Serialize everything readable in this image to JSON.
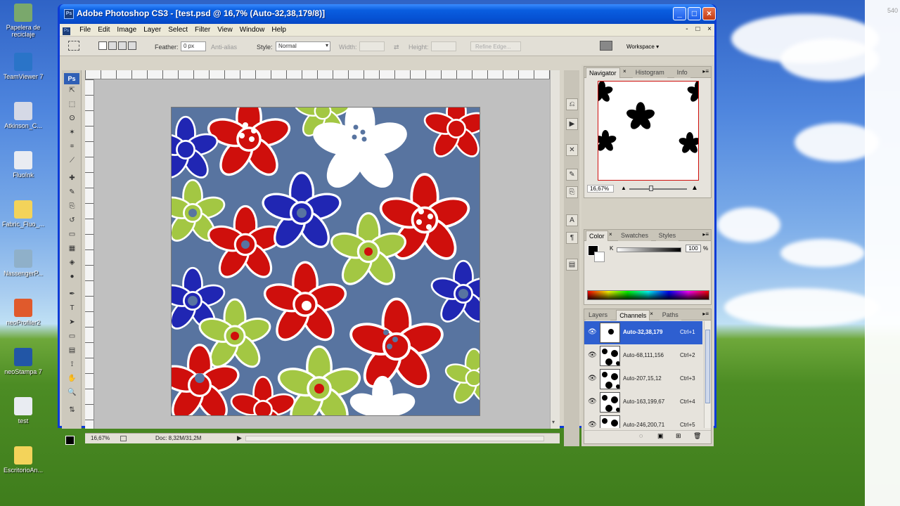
{
  "desktop": {
    "icons": [
      {
        "label": "Papelera de reciclaje",
        "icon": "recycle-bin-icon",
        "color": "#7aa86c"
      },
      {
        "label": "TeamViewer 7",
        "icon": "teamviewer-icon",
        "color": "#2a74c8"
      },
      {
        "label": "Atkinson_C...",
        "icon": "tiff-file-icon",
        "color": "#d5d9e6"
      },
      {
        "label": "FluoInk",
        "icon": "document-icon",
        "color": "#e9ecf2"
      },
      {
        "label": "Fabric_Fluo_...",
        "icon": "folder-icon",
        "color": "#f3d35a"
      },
      {
        "label": "NassengerP...",
        "icon": "app-icon",
        "color": "#8fb0c9"
      },
      {
        "label": "neoProfiler2",
        "icon": "app-icon",
        "color": "#e05a2c"
      },
      {
        "label": "neoStampa 7",
        "icon": "app-icon",
        "color": "#2256a6"
      },
      {
        "label": "test",
        "icon": "document-icon",
        "color": "#e9ecf2"
      },
      {
        "label": "EscritorioAn...",
        "icon": "folder-icon",
        "color": "#f3d35a"
      }
    ],
    "corner_text": "540"
  },
  "window": {
    "app_badge": "Ps",
    "title": "Adobe Photoshop CS3 - [test.psd @ 16,7% (Auto-32,38,179/8)]",
    "buttons": {
      "minimize": "_",
      "maximize": "□",
      "close": "×"
    }
  },
  "menu": {
    "items": [
      "File",
      "Edit",
      "Image",
      "Layer",
      "Select",
      "Filter",
      "View",
      "Window",
      "Help"
    ],
    "doc_controls": [
      "-",
      "□",
      "×"
    ]
  },
  "options": {
    "feather_label": "Feather:",
    "feather_value": "0 px",
    "antialias_label": "Anti-alias",
    "style_label": "Style:",
    "style_value": "Normal",
    "width_label": "Width:",
    "height_label": "Height:",
    "refine_edge": "Refine Edge...",
    "workspace": "Workspace ▾"
  },
  "status": {
    "zoom": "16,67%",
    "doc": "Doc: 8,32M/31,2M"
  },
  "navigator": {
    "tabs": [
      "Navigator",
      "Histogram",
      "Info"
    ],
    "active_tab": "Navigator",
    "zoom": "16,67%"
  },
  "color_panel": {
    "tabs": [
      "Color",
      "Swatches",
      "Styles"
    ],
    "active_tab": "Color",
    "k_label": "K",
    "k_value": "100",
    "percent": "%"
  },
  "channels_panel": {
    "tabs": [
      "Layers",
      "Channels",
      "Paths"
    ],
    "active_tab": "Channels",
    "rows": [
      {
        "name": "Auto-32,38,179",
        "shortcut": "Ctrl+1",
        "selected": true
      },
      {
        "name": "Auto-68,111,156",
        "shortcut": "Ctrl+2",
        "selected": false
      },
      {
        "name": "Auto-207,15,12",
        "shortcut": "Ctrl+3",
        "selected": false
      },
      {
        "name": "Auto-163,199,67",
        "shortcut": "Ctrl+4",
        "selected": false
      },
      {
        "name": "Auto-246,200,71",
        "shortcut": "Ctrl+5",
        "selected": false
      }
    ]
  },
  "colors": {
    "xp_blue": "#0c3bd6",
    "flower_red": "#cf0f0c",
    "flower_blue": "#2026b3",
    "flower_green": "#a3c743",
    "flower_white": "#ffffff",
    "background_slate": "#5874a0"
  }
}
